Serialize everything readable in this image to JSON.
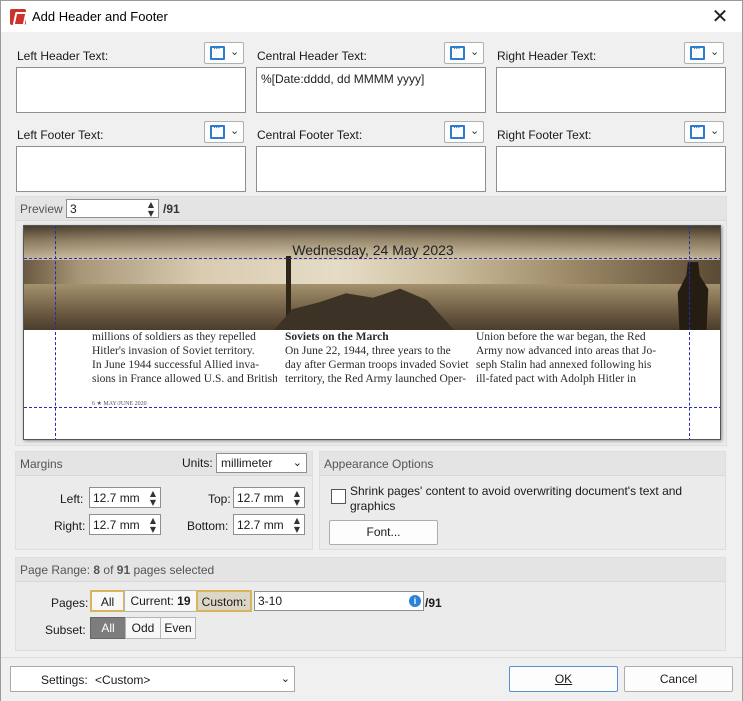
{
  "window": {
    "title": "Add Header and Footer",
    "close_glyph": "✕"
  },
  "fields": {
    "left_header": {
      "label": "Left Header Text:",
      "value": ""
    },
    "central_header": {
      "label": "Central Header Text:",
      "value": "%[Date:dddd, dd MMMM yyyy]"
    },
    "right_header": {
      "label": "Right Header Text:",
      "value": ""
    },
    "left_footer": {
      "label": "Left Footer Text:",
      "value": ""
    },
    "central_footer": {
      "label": "Central Footer Text:",
      "value": ""
    },
    "right_footer": {
      "label": "Right Footer Text:",
      "value": ""
    },
    "macro_icon": "insert-macro-icon",
    "caret": "⌄"
  },
  "preview": {
    "label": "Preview",
    "page": "3",
    "total": "/91",
    "header_text": "Wednesday, 24 May 2023",
    "col1": [
      "millions of soldiers as they repelled",
      "Hitler's invasion of Soviet territory.",
      "    In June 1944 successful Allied inva-",
      "sions in France allowed U.S. and British"
    ],
    "col2": [
      "Soviets on the March",
      "On June 22, 1944, three years to the",
      "day after German troops invaded Soviet",
      "territory, the Red Army launched Oper-"
    ],
    "col3": [
      "Union before the war began, the Red",
      "Army now advanced into areas that Jo-",
      "seph Stalin had annexed following his",
      "ill-fated pact with Adolph Hitler in"
    ],
    "tiny_footer": "6  ★ MAY/JUNE 2020"
  },
  "margins": {
    "title": "Margins",
    "units_label": "Units:",
    "units_value": "millimeter",
    "left_label": "Left:",
    "left_value": "12.7 mm",
    "top_label": "Top:",
    "top_value": "12.7 mm",
    "right_label": "Right:",
    "right_value": "12.7 mm",
    "bottom_label": "Bottom:",
    "bottom_value": "12.7 mm"
  },
  "appearance": {
    "title": "Appearance Options",
    "shrink_label_1": "Shrink pages' content to avoid overwriting document's text and",
    "shrink_label_2": "graphics",
    "shrink_checked": false,
    "font_button": "Font..."
  },
  "page_range": {
    "title_prefix": "Page Range: ",
    "selected": "8",
    "of_text": " of ",
    "total": "91",
    "suffix": " pages selected",
    "pages_label": "Pages:",
    "all": "All",
    "current": "Current: ",
    "current_value": "19",
    "custom": "Custom:",
    "custom_value": "3-10",
    "custom_total": "/91",
    "subset_label": "Subset:",
    "subset_all": "All",
    "subset_odd": "Odd",
    "subset_even": "Even"
  },
  "footer": {
    "settings_label": "Settings:",
    "settings_value": "<Custom>",
    "ok": "OK",
    "cancel": "Cancel"
  },
  "colors": {
    "accent": "#2c7bd3",
    "guide": "#2a2ab8",
    "app_icon": "#d0302a",
    "selected_dark": "#7d7d7d"
  }
}
